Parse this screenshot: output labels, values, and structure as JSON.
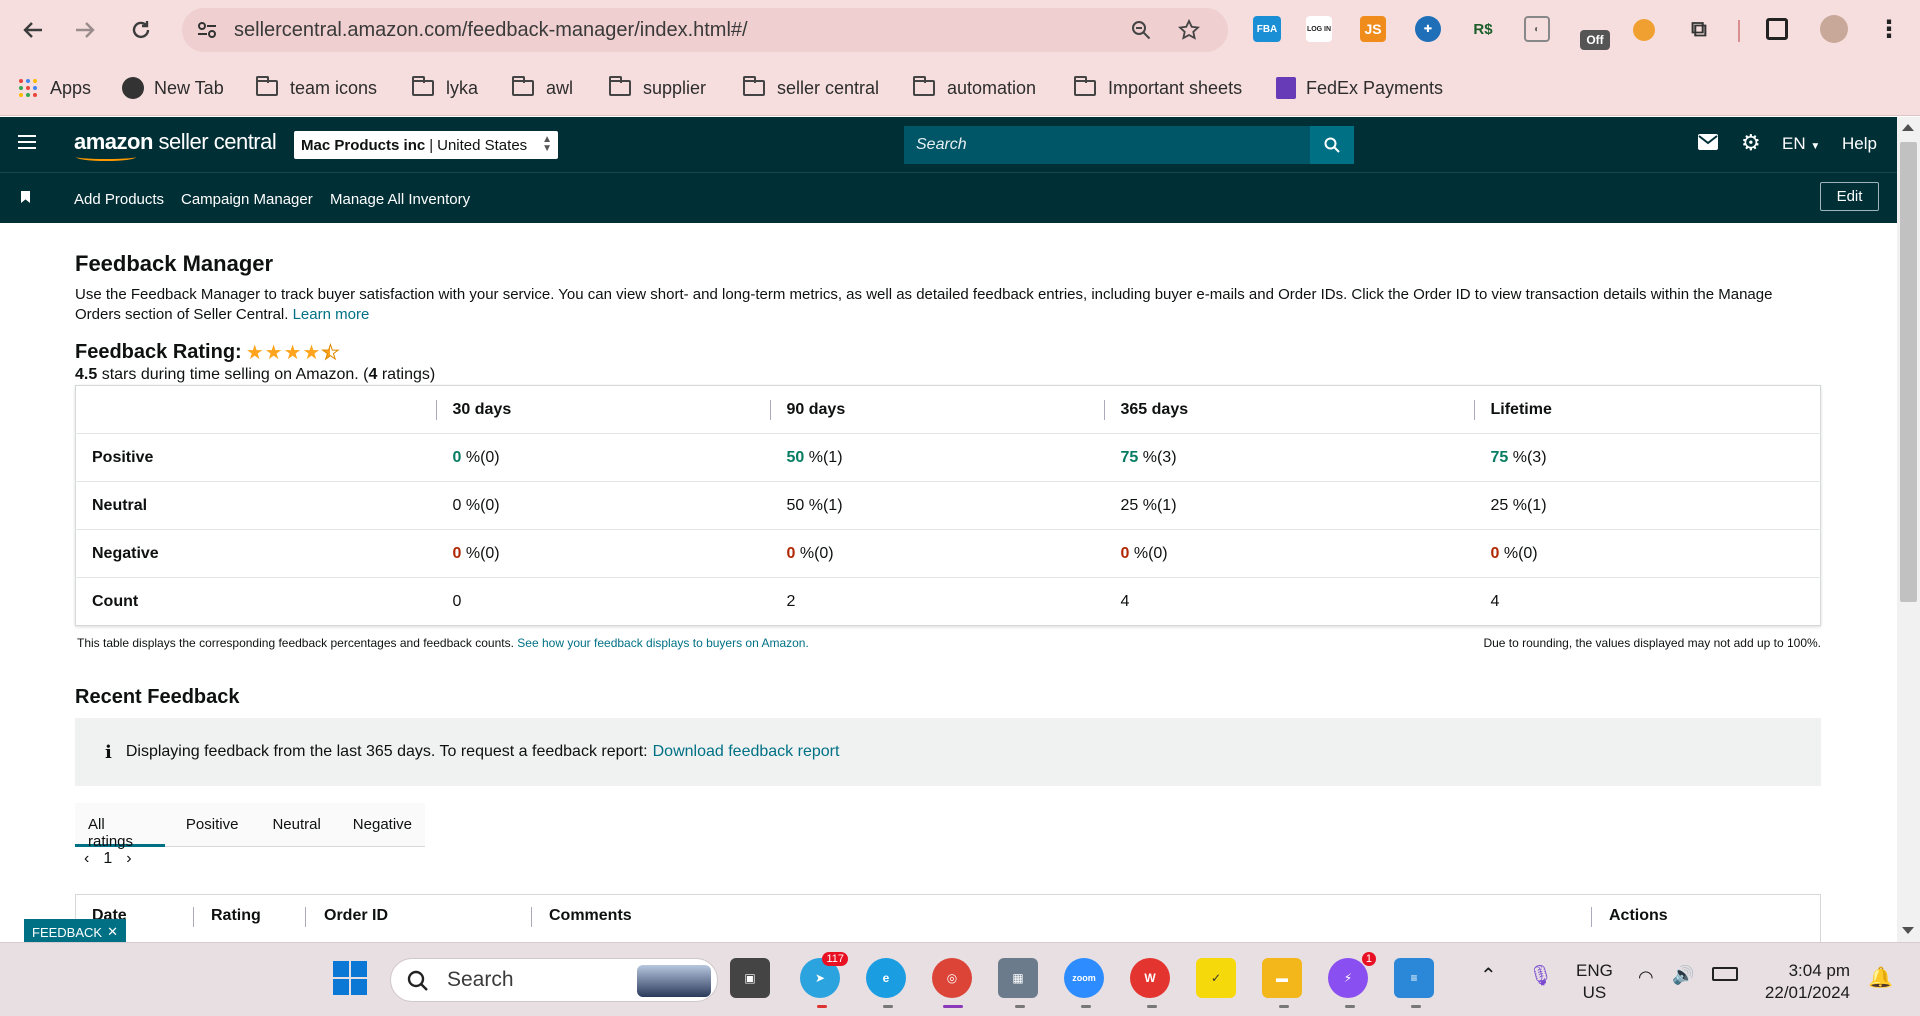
{
  "browser": {
    "url": "sellercentral.amazon.com/feedback-manager/index.html#/",
    "bookmarks": [
      "Apps",
      "New Tab",
      "team icons",
      "lyka",
      "awl",
      "supplier",
      "seller central",
      "automation",
      "Important sheets",
      "FedEx Payments"
    ],
    "extension_off_label": "Off",
    "ext_fba": "FBA",
    "ext_js": "JS",
    "ext_rs": "R$",
    "ext_login": "LOG IN"
  },
  "header": {
    "logo_bold": "amazon",
    "logo_rest": " seller central",
    "account_name": "Mac Products inc",
    "account_region": "United States",
    "search_placeholder": "Search",
    "language": "EN",
    "help": "Help"
  },
  "nav": {
    "links": [
      "Add Products",
      "Campaign Manager",
      "Manage All Inventory"
    ],
    "edit": "Edit"
  },
  "page": {
    "title": "Feedback Manager",
    "description": "Use the Feedback Manager to track buyer satisfaction with your service. You can view short- and long-term metrics, as well as detailed feedback entries, including buyer e-mails and Order IDs. Click the Order ID to view transaction details within the Manage Orders section of Seller Central.",
    "learn_more": "Learn more",
    "rating_label": "Feedback Rating:",
    "rating_value": "4.5",
    "rating_text": " stars during time selling on Amazon. (",
    "rating_count": "4",
    "rating_suffix": " ratings)"
  },
  "metrics": {
    "columns": [
      "30 days",
      "90 days",
      "365 days",
      "Lifetime"
    ],
    "rows": [
      {
        "label": "Positive",
        "values": [
          [
            "0",
            " %(0)"
          ],
          [
            "50",
            " %(1)"
          ],
          [
            "75",
            " %(3)"
          ],
          [
            "75",
            " %(3)"
          ]
        ]
      },
      {
        "label": "Neutral",
        "values": [
          [
            "0",
            " %(0)"
          ],
          [
            "50",
            " %(1)"
          ],
          [
            "25",
            " %(1)"
          ],
          [
            "25",
            " %(1)"
          ]
        ]
      },
      {
        "label": "Negative",
        "values": [
          [
            "0",
            " %(0)"
          ],
          [
            "0",
            " %(0)"
          ],
          [
            "0",
            " %(0)"
          ],
          [
            "0",
            " %(0)"
          ]
        ]
      },
      {
        "label": "Count",
        "values": [
          [
            "0",
            ""
          ],
          [
            "2",
            ""
          ],
          [
            "4",
            ""
          ],
          [
            "4",
            ""
          ]
        ]
      }
    ],
    "note_left": "This table displays the corresponding feedback percentages and feedback counts.",
    "note_left_link": "See how your feedback displays to buyers on Amazon.",
    "note_right": "Due to rounding, the values displayed may not add up to 100%."
  },
  "recent": {
    "title": "Recent Feedback",
    "info_text": "Displaying feedback from the last 365 days. To request a feedback report:",
    "info_link": "Download feedback report",
    "tabs": [
      "All ratings",
      "Positive",
      "Neutral",
      "Negative"
    ],
    "active_tab": "All ratings",
    "page": "1",
    "columns": [
      "Date",
      "Rating",
      "Order ID",
      "Comments",
      "Actions"
    ],
    "feedback_tab": "FEEDBACK"
  },
  "taskbar": {
    "search": "Search",
    "telegram_badge": "117",
    "messenger_badge": "1",
    "lang_top": "ENG",
    "lang_bottom": "US",
    "time": "3:04 pm",
    "date": "22/01/2024",
    "zoom_label": "zoom"
  }
}
